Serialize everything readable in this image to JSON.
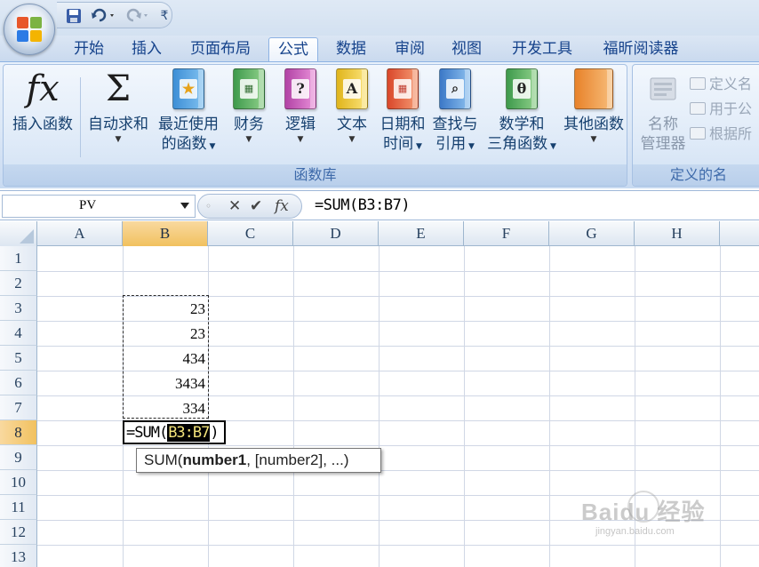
{
  "qat": {
    "customize_glyph": "₹"
  },
  "tabs": [
    "开始",
    "插入",
    "页面布局",
    "公式",
    "数据",
    "审阅",
    "视图",
    "开发工具",
    "福昕阅读器"
  ],
  "active_tab": "公式",
  "ribbon": {
    "group_function_library": {
      "label": "函数库",
      "insert_function": {
        "icon_text": "fx",
        "label": "插入函数"
      },
      "autosum": {
        "icon_text": "Σ",
        "label": "自动求和"
      },
      "recent": {
        "label_line1": "最近使用",
        "label_line2": "的函数"
      },
      "financial": {
        "label": "财务"
      },
      "logical": {
        "label": "逻辑"
      },
      "text": {
        "label": "文本"
      },
      "datetime": {
        "label_line1": "日期和",
        "label_line2": "时间"
      },
      "lookup": {
        "label_line1": "查找与",
        "label_line2": "引用"
      },
      "math": {
        "label_line1": "数学和",
        "label_line2": "三角函数"
      },
      "more": {
        "label": "其他函数"
      }
    },
    "group_defined_names": {
      "label": "定义的名",
      "name_manager": {
        "label_line1": "名称",
        "label_line2": "管理器"
      },
      "define_name": "定义名",
      "use_in_formula": "用于公",
      "create_from_selection": "根据所"
    }
  },
  "formula_bar": {
    "name_box": "PV",
    "fx_glyph": "fx",
    "formula": "=SUM(B3:B7)"
  },
  "sheet": {
    "columns": [
      "A",
      "B",
      "C",
      "D",
      "E",
      "F",
      "G",
      "H"
    ],
    "selected_column": "B",
    "rows": [
      "1",
      "2",
      "3",
      "4",
      "5",
      "6",
      "7",
      "8",
      "9",
      "10",
      "11",
      "12",
      "13"
    ],
    "selected_row": "8",
    "values": {
      "B3": "23",
      "B4": "23",
      "B5": "434",
      "B6": "3434",
      "B7": "334"
    },
    "editing_cell": {
      "prefix": "=SUM(",
      "ref": "B3:B7",
      "suffix": ")"
    },
    "tooltip": {
      "fn": "SUM(",
      "arg1": "number1",
      "rest": ", [number2], ...)"
    }
  },
  "watermark": {
    "brand": "Baidu 经验",
    "url": "jingyan.baidu.com"
  },
  "colors": {
    "accent": "#15428b",
    "selected_header": "#f1c15f",
    "ref_highlight": "#f3e37a"
  }
}
